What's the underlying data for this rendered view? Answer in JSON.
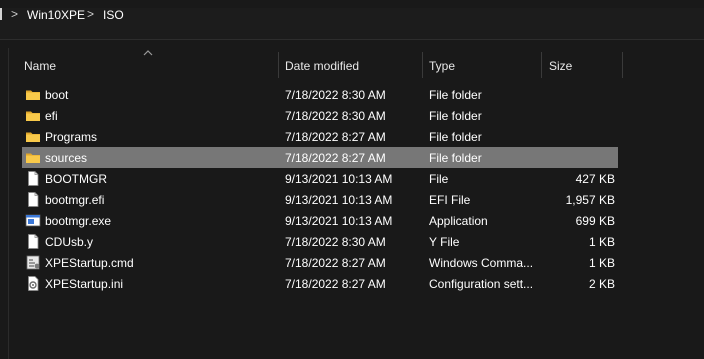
{
  "breadcrumb": {
    "items": [
      "Win10XPE",
      "ISO"
    ],
    "separator": ">"
  },
  "columns": {
    "name": "Name",
    "date": "Date modified",
    "type": "Type",
    "size": "Size"
  },
  "files": [
    {
      "name": "boot",
      "date": "7/18/2022 8:30 AM",
      "type": "File folder",
      "size": "",
      "icon": "folder-icon"
    },
    {
      "name": "efi",
      "date": "7/18/2022 8:30 AM",
      "type": "File folder",
      "size": "",
      "icon": "folder-icon"
    },
    {
      "name": "Programs",
      "date": "7/18/2022 8:27 AM",
      "type": "File folder",
      "size": "",
      "icon": "folder-icon"
    },
    {
      "name": "sources",
      "date": "7/18/2022 8:27 AM",
      "type": "File folder",
      "size": "",
      "icon": "folder-icon",
      "selected": true
    },
    {
      "name": "BOOTMGR",
      "date": "9/13/2021 10:13 AM",
      "type": "File",
      "size": "427 KB",
      "icon": "file-icon"
    },
    {
      "name": "bootmgr.efi",
      "date": "9/13/2021 10:13 AM",
      "type": "EFI File",
      "size": "1,957 KB",
      "icon": "file-icon"
    },
    {
      "name": "bootmgr.exe",
      "date": "9/13/2021 10:13 AM",
      "type": "Application",
      "size": "699 KB",
      "icon": "application-icon"
    },
    {
      "name": "CDUsb.y",
      "date": "7/18/2022 8:30 AM",
      "type": "Y File",
      "size": "1 KB",
      "icon": "file-icon"
    },
    {
      "name": "XPEStartup.cmd",
      "date": "7/18/2022 8:27 AM",
      "type": "Windows Comma...",
      "size": "1 KB",
      "icon": "script-icon"
    },
    {
      "name": "XPEStartup.ini",
      "date": "7/18/2022 8:27 AM",
      "type": "Configuration sett...",
      "size": "2 KB",
      "icon": "settings-file-icon"
    }
  ],
  "colors": {
    "background": "#191919",
    "selection": "#777777",
    "folder": "#f8c94a",
    "text": "#ffffff"
  }
}
